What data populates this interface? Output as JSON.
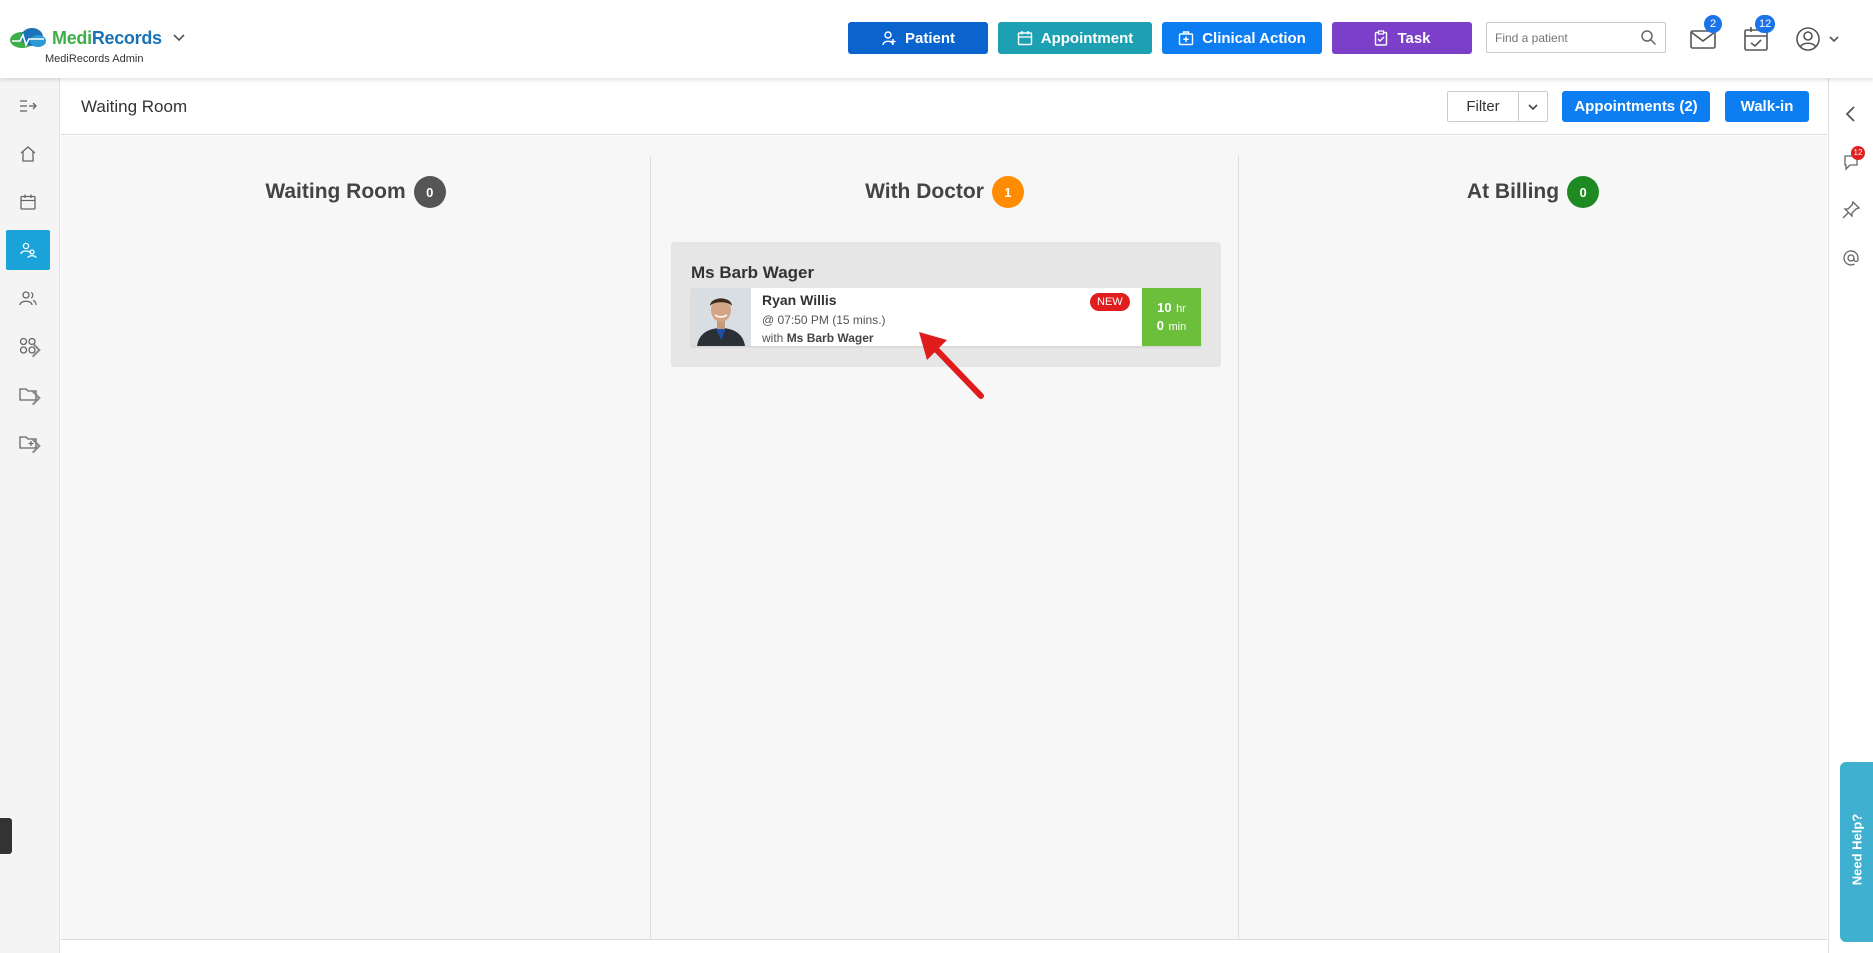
{
  "brand": {
    "name_part1": "Medi",
    "name_part2": "Records",
    "subtitle": "MediRecords Admin"
  },
  "header": {
    "actions": [
      {
        "label": "Patient",
        "icon": "user-plus-icon",
        "color": "#0b63ce"
      },
      {
        "label": "Appointment",
        "icon": "calendar-icon",
        "color": "#1da1b2"
      },
      {
        "label": "Clinical Action",
        "icon": "medical-bag-icon",
        "color": "#0d7ef2"
      },
      {
        "label": "Task",
        "icon": "clipboard-icon",
        "color": "#7b3fc9"
      }
    ],
    "search_placeholder": "Find a patient",
    "messages_count": "2",
    "tasks_count": "12"
  },
  "content": {
    "title": "Waiting Room",
    "filter_label": "Filter",
    "appointments_label": "Appointments (2)",
    "walkin_label": "Walk-in"
  },
  "columns": [
    {
      "title": "Waiting Room",
      "count": "0",
      "badge_color": "#555555"
    },
    {
      "title": "With Doctor",
      "count": "1",
      "badge_color": "#ff8c00"
    },
    {
      "title": "At Billing",
      "count": "0",
      "badge_color": "#1e8a21"
    }
  ],
  "with_doctor_group": {
    "doctor": "Ms Barb Wager",
    "patient": {
      "name": "Ryan Willis",
      "time": "@ 07:50 PM (15 mins.)",
      "with_prefix": "with",
      "with_doctor": "Ms Barb Wager",
      "status_badge": "NEW",
      "elapsed_hours": "10",
      "hours_unit": "hr",
      "elapsed_minutes": "0",
      "minutes_unit": "min"
    }
  },
  "right_rail": {
    "notifications_count": "12",
    "help_label": "Need Help?"
  }
}
